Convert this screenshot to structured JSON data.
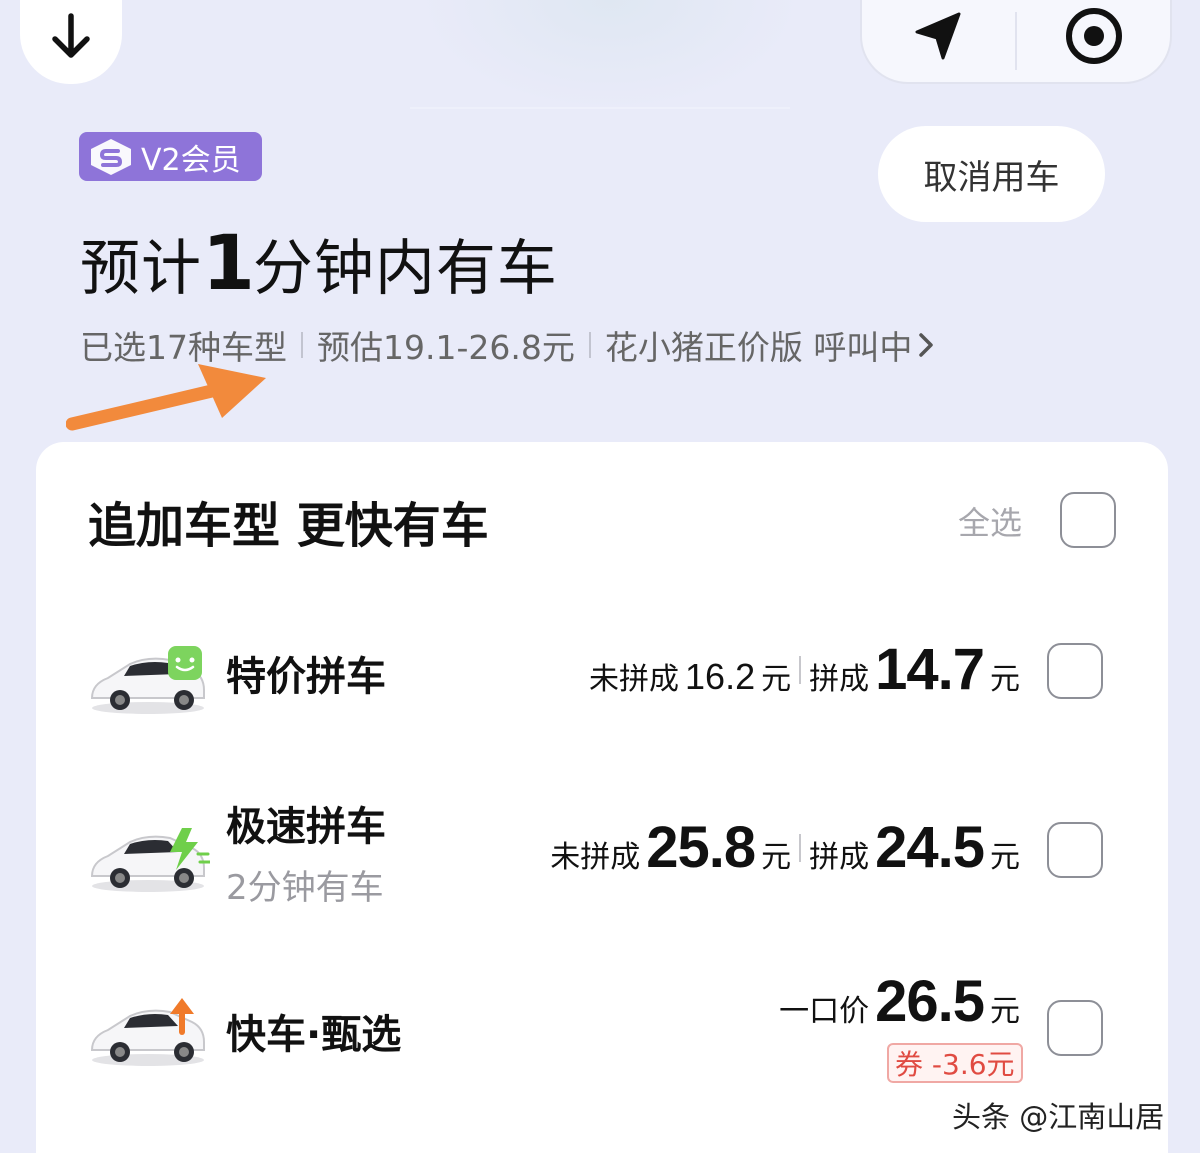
{
  "header": {
    "member_badge": "V2会员",
    "cancel_button": "取消用车",
    "eta": {
      "prefix": "预计",
      "number": "1",
      "suffix": "分钟内有车"
    },
    "summary": {
      "selected": "已选17种车型",
      "estimate": "预估19.1-26.8元",
      "status": "花小猪正价版 呼叫中"
    }
  },
  "panel": {
    "title": "追加车型 更快有车",
    "select_all": "全选",
    "options": [
      {
        "name": "特价拼车",
        "sub": "",
        "unpooled_label": "未拼成",
        "unpooled_price": "16.2",
        "pooled_label": "拼成",
        "pooled_price": "14.7",
        "unit": "元",
        "icon": "car-smiley-icon",
        "checked": false
      },
      {
        "name": "极速拼车",
        "sub": "2分钟有车",
        "unpooled_label": "未拼成",
        "unpooled_price": "25.8",
        "pooled_label": "拼成",
        "pooled_price": "24.5",
        "unit": "元",
        "icon": "car-lightning-icon",
        "checked": false
      },
      {
        "name": "快车·甄选",
        "fixed_label": "一口价",
        "fixed_price": "26.5",
        "unit": "元",
        "coupon": "券 -3.6元",
        "icon": "car-upgrade-icon",
        "checked": false
      }
    ]
  },
  "watermark": "头条 @江南山居",
  "colors": {
    "background": "#e9ebf9",
    "badge": "#8e74d9",
    "arrow": "#f28a3c",
    "coupon": "#e04b42"
  }
}
